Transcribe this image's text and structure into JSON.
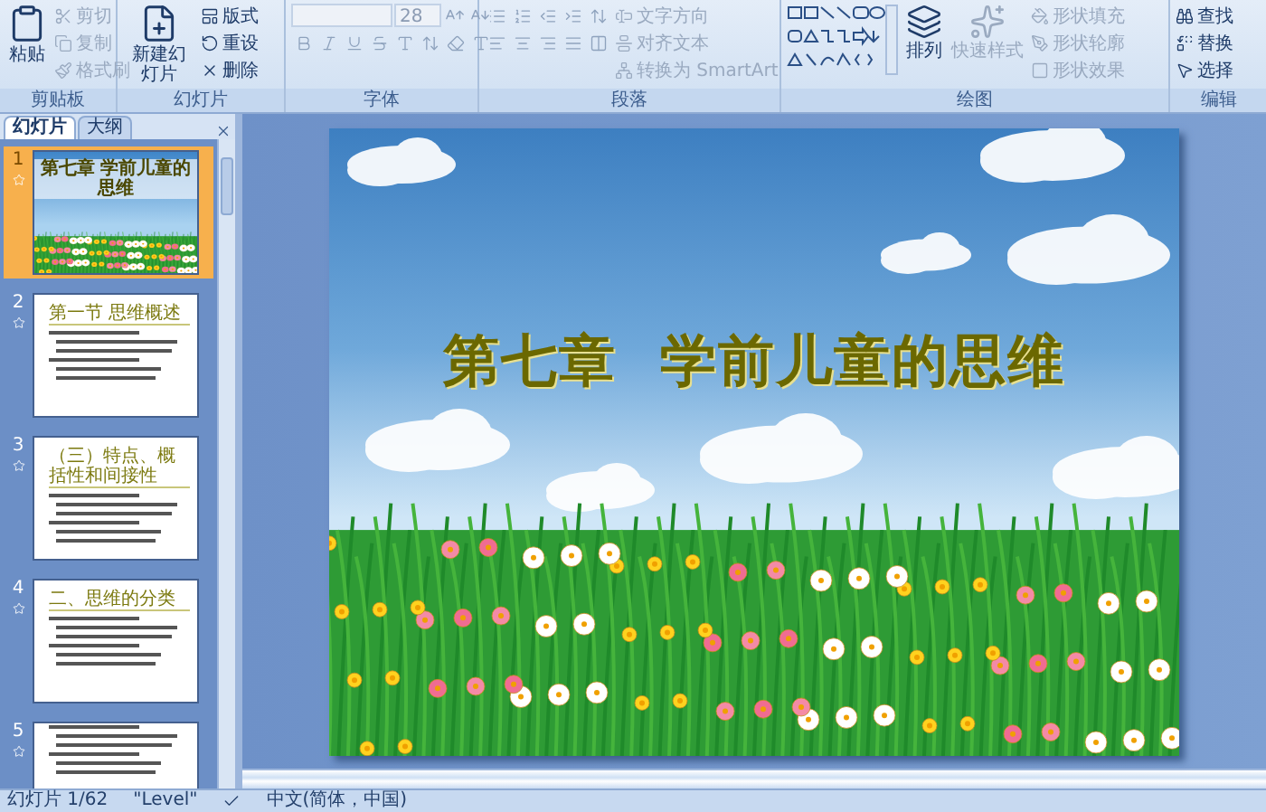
{
  "ribbon": {
    "groups": [
      {
        "kind": "clipboard",
        "label": "剪贴板",
        "large": {
          "label": "粘贴",
          "disabled": false
        },
        "small": [
          {
            "label": "剪切",
            "disabled": true
          },
          {
            "label": "复制",
            "disabled": true
          },
          {
            "label": "格式刷",
            "disabled": true
          }
        ]
      },
      {
        "kind": "slides",
        "label": "幻灯片",
        "large": {
          "label": "新建幻灯片",
          "disabled": false
        },
        "small": [
          {
            "label": "版式",
            "disabled": false
          },
          {
            "label": "重设",
            "disabled": false
          },
          {
            "label": "删除",
            "disabled": false
          }
        ]
      },
      {
        "kind": "font",
        "label": "字体",
        "font_size": "28",
        "disabled": true
      },
      {
        "kind": "paragraph",
        "label": "段落",
        "small": [
          {
            "label": "文字方向",
            "disabled": true
          },
          {
            "label": "对齐文本",
            "disabled": true
          },
          {
            "label": "转换为 SmartArt",
            "disabled": true
          }
        ]
      },
      {
        "kind": "drawing",
        "label": "绘图",
        "large": [
          {
            "label": "排列",
            "disabled": false
          },
          {
            "label": "快速样式",
            "disabled": true
          }
        ],
        "small": [
          {
            "label": "形状填充",
            "disabled": true
          },
          {
            "label": "形状轮廓",
            "disabled": true
          },
          {
            "label": "形状效果",
            "disabled": true
          }
        ]
      },
      {
        "kind": "editing",
        "label": "编辑",
        "small": [
          {
            "label": "查找",
            "disabled": false
          },
          {
            "label": "替换",
            "disabled": false
          },
          {
            "label": "选择",
            "disabled": false
          }
        ]
      }
    ]
  },
  "pane": {
    "tabs": [
      {
        "label": "幻灯片",
        "selected": true
      },
      {
        "label": "大纲",
        "selected": false
      }
    ],
    "slides": [
      {
        "number": "1",
        "kind": "title",
        "selected": true,
        "title": "第七章 学前儿童的思维"
      },
      {
        "number": "2",
        "kind": "content",
        "selected": false,
        "title": "第一节 思维概述"
      },
      {
        "number": "3",
        "kind": "content",
        "selected": false,
        "title": "（三）特点、概括性和间接性"
      },
      {
        "number": "4",
        "kind": "content",
        "selected": false,
        "title": "二、思维的分类"
      },
      {
        "number": "5",
        "kind": "content",
        "selected": false
      }
    ]
  },
  "slide": {
    "title": "第七章  学前儿童的思维"
  },
  "status_bar": {
    "slide": "幻灯片 1/62",
    "theme": "\"Level\"",
    "language": "中文(简体，中国)"
  }
}
